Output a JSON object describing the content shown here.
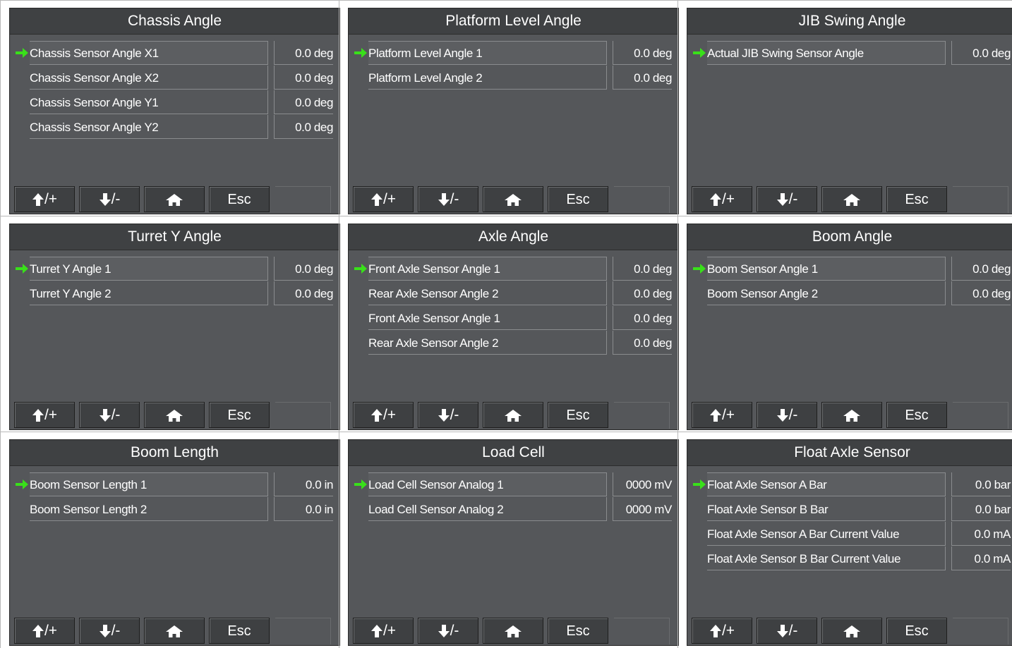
{
  "buttons": {
    "up_icon": "arrow-up-icon",
    "up_label": "/+",
    "down_icon": "arrow-down-icon",
    "down_label": "/-",
    "home_icon": "home-icon",
    "esc_label": "Esc"
  },
  "colors": {
    "screen_bg": "#55575a",
    "titlebar_bg": "#3f4143",
    "text": "#ffffff",
    "selection_arrow": "#39e01a"
  },
  "panels": [
    {
      "title": "Chassis Angle",
      "rows": [
        {
          "label": "Chassis Sensor Angle X1",
          "value": "0.0 deg",
          "selected": true
        },
        {
          "label": "Chassis Sensor Angle X2",
          "value": "0.0 deg",
          "selected": false
        },
        {
          "label": "Chassis Sensor Angle Y1",
          "value": "0.0 deg",
          "selected": false
        },
        {
          "label": "Chassis Sensor Angle Y2",
          "value": "0.0 deg",
          "selected": false
        }
      ]
    },
    {
      "title": "Platform Level Angle",
      "rows": [
        {
          "label": "Platform Level Angle 1",
          "value": "0.0 deg",
          "selected": true
        },
        {
          "label": "Platform Level Angle 2",
          "value": "0.0 deg",
          "selected": false
        }
      ]
    },
    {
      "title": "JIB Swing Angle",
      "rows": [
        {
          "label": "Actual JIB Swing Sensor Angle",
          "value": "0.0 deg",
          "selected": true
        }
      ]
    },
    {
      "title": "Turret Y Angle",
      "rows": [
        {
          "label": "Turret Y Angle 1",
          "value": "0.0 deg",
          "selected": true
        },
        {
          "label": "Turret Y Angle 2",
          "value": "0.0 deg",
          "selected": false
        }
      ]
    },
    {
      "title": "Axle Angle",
      "rows": [
        {
          "label": "Front Axle Sensor Angle 1",
          "value": "0.0 deg",
          "selected": true
        },
        {
          "label": "Rear Axle Sensor Angle 2",
          "value": "0.0 deg",
          "selected": false
        },
        {
          "label": "Front Axle Sensor Angle 1",
          "value": "0.0 deg",
          "selected": false
        },
        {
          "label": "Rear Axle Sensor Angle 2",
          "value": "0.0 deg",
          "selected": false
        }
      ]
    },
    {
      "title": "Boom Angle",
      "rows": [
        {
          "label": "Boom Sensor Angle 1",
          "value": "0.0 deg",
          "selected": true
        },
        {
          "label": "Boom Sensor Angle 2",
          "value": "0.0 deg",
          "selected": false
        }
      ]
    },
    {
      "title": "Boom Length",
      "rows": [
        {
          "label": "Boom Sensor Length 1",
          "value": "0.0 in",
          "selected": true
        },
        {
          "label": "Boom Sensor Length 2",
          "value": "0.0 in",
          "selected": false
        }
      ]
    },
    {
      "title": "Load Cell",
      "rows": [
        {
          "label": "Load Cell Sensor Analog 1",
          "value": "0000 mV",
          "selected": true
        },
        {
          "label": "Load Cell Sensor Analog 2",
          "value": "0000 mV",
          "selected": false
        }
      ]
    },
    {
      "title": "Float Axle Sensor",
      "rows": [
        {
          "label": "Float Axle Sensor A Bar",
          "value": "0.0 bar",
          "selected": true
        },
        {
          "label": "Float Axle Sensor B Bar",
          "value": "0.0 bar",
          "selected": false
        },
        {
          "label": "Float Axle Sensor A Bar Current Value",
          "value": "0.0 mA",
          "selected": false
        },
        {
          "label": "Float Axle Sensor B Bar Current Value",
          "value": "0.0 mA",
          "selected": false
        }
      ]
    }
  ]
}
